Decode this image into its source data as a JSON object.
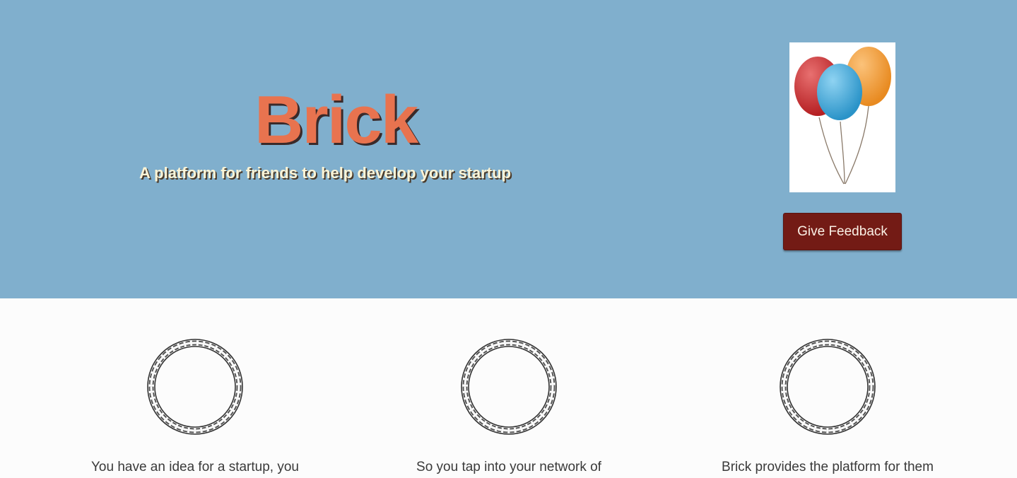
{
  "hero": {
    "title": "Brick",
    "tagline": "A platform for friends to help develop your startup",
    "image_icon": "balloons-icon",
    "feedback_button": "Give Feedback"
  },
  "features": [
    {
      "icon": "braided-ring-icon",
      "text": "You have an idea for a startup, you"
    },
    {
      "icon": "braided-ring-icon",
      "text": "So you tap into your network of"
    },
    {
      "icon": "braided-ring-icon",
      "text": "Brick provides the platform for them"
    }
  ],
  "colors": {
    "hero_background": "#80afcd",
    "title": "#e8734f",
    "tagline": "#fbf4d6",
    "button": "#731b15",
    "page_background": "#fcfcfc"
  }
}
